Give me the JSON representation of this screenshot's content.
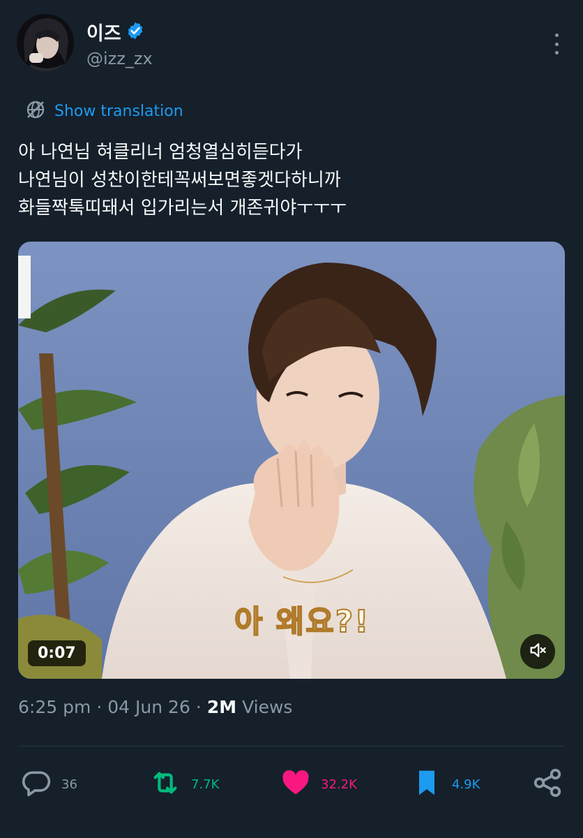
{
  "author": {
    "display_name": "이즈",
    "handle": "@izz_zx",
    "verified": true,
    "verified_color": "#1d9bf0"
  },
  "translation": {
    "label": "Show translation"
  },
  "tweet": {
    "lines": [
      "아 나연님 혀클리너 엄청열심히듣다가",
      "나연님이 성찬이한테꼭써보면좋겟다하니까",
      "화들짝툭띠돼서 입가리는서 개존귀야ㅜㅜㅜ"
    ]
  },
  "media": {
    "duration": "0:07",
    "caption": "아 왜요?!",
    "mute_icon": "speaker-muted-icon"
  },
  "meta": {
    "time": "6:25 pm",
    "sep1": "·",
    "date": "04 Jun 26",
    "sep2": "·",
    "views_count": "2M",
    "views_label": "Views"
  },
  "actions": {
    "reply_count": "36",
    "retweet_count": "7.7K",
    "like_count": "32.2K",
    "bookmark_count": "4.9K"
  },
  "colors": {
    "background": "#15202b",
    "secondary_text": "#8b98a5",
    "accent": "#1d9bf0",
    "retweet": "#00ba7c",
    "like": "#f91880"
  }
}
